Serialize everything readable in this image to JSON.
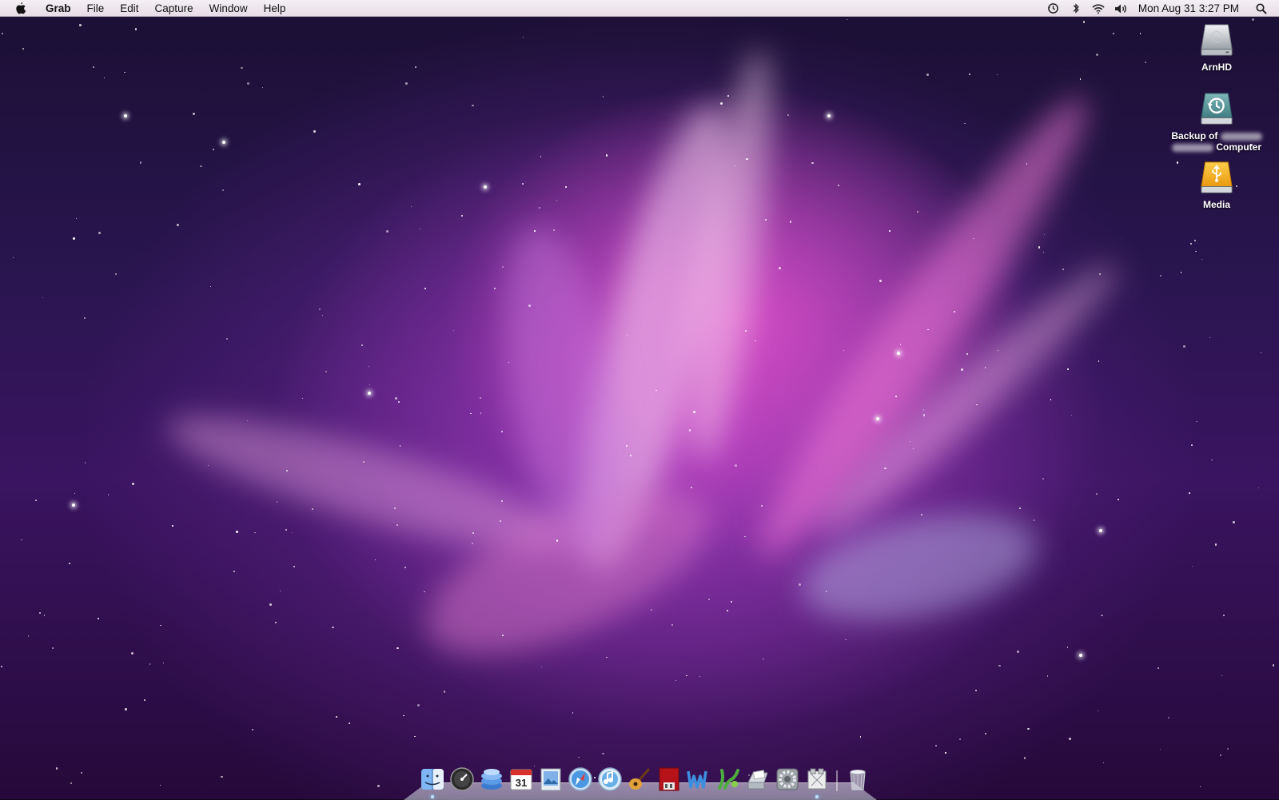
{
  "menubar": {
    "app_name": "Grab",
    "menus": [
      "File",
      "Edit",
      "Capture",
      "Window",
      "Help"
    ],
    "clock": "Mon Aug 31  3:27 PM",
    "status_icons": [
      "time-machine-icon",
      "bluetooth-icon",
      "wifi-icon",
      "volume-icon",
      "spotlight-icon"
    ]
  },
  "desktop": {
    "icons": [
      {
        "name": "hard-drive-icon",
        "label": "ArnHD"
      },
      {
        "name": "time-machine-backup-icon",
        "label_line1": "Backup of",
        "label_line2": "Computer"
      },
      {
        "name": "usb-drive-icon",
        "label": "Media"
      }
    ]
  },
  "dock": {
    "items": [
      {
        "name": "finder-icon",
        "running": true
      },
      {
        "name": "dashboard-icon",
        "running": false
      },
      {
        "name": "stack-icon",
        "running": false
      },
      {
        "name": "ical-icon",
        "date": "31",
        "running": false
      },
      {
        "name": "preview-icon",
        "running": false
      },
      {
        "name": "safari-icon",
        "running": false
      },
      {
        "name": "itunes-icon",
        "running": false
      },
      {
        "name": "garageband-icon",
        "running": false
      },
      {
        "name": "photobooth-icon",
        "running": false
      },
      {
        "name": "iweb-icon",
        "running": false
      },
      {
        "name": "network-icon",
        "running": false
      },
      {
        "name": "scanner-icon",
        "running": false
      },
      {
        "name": "system-preferences-icon",
        "running": false
      },
      {
        "name": "grab-icon",
        "running": true
      }
    ],
    "trash": {
      "name": "trash-icon"
    }
  },
  "colors": {
    "wallpaper_deep": "#1a0f33",
    "wallpaper_magenta": "#de50c8",
    "wallpaper_purple": "#6928 96",
    "menubar_top": "#f4f0f4"
  }
}
